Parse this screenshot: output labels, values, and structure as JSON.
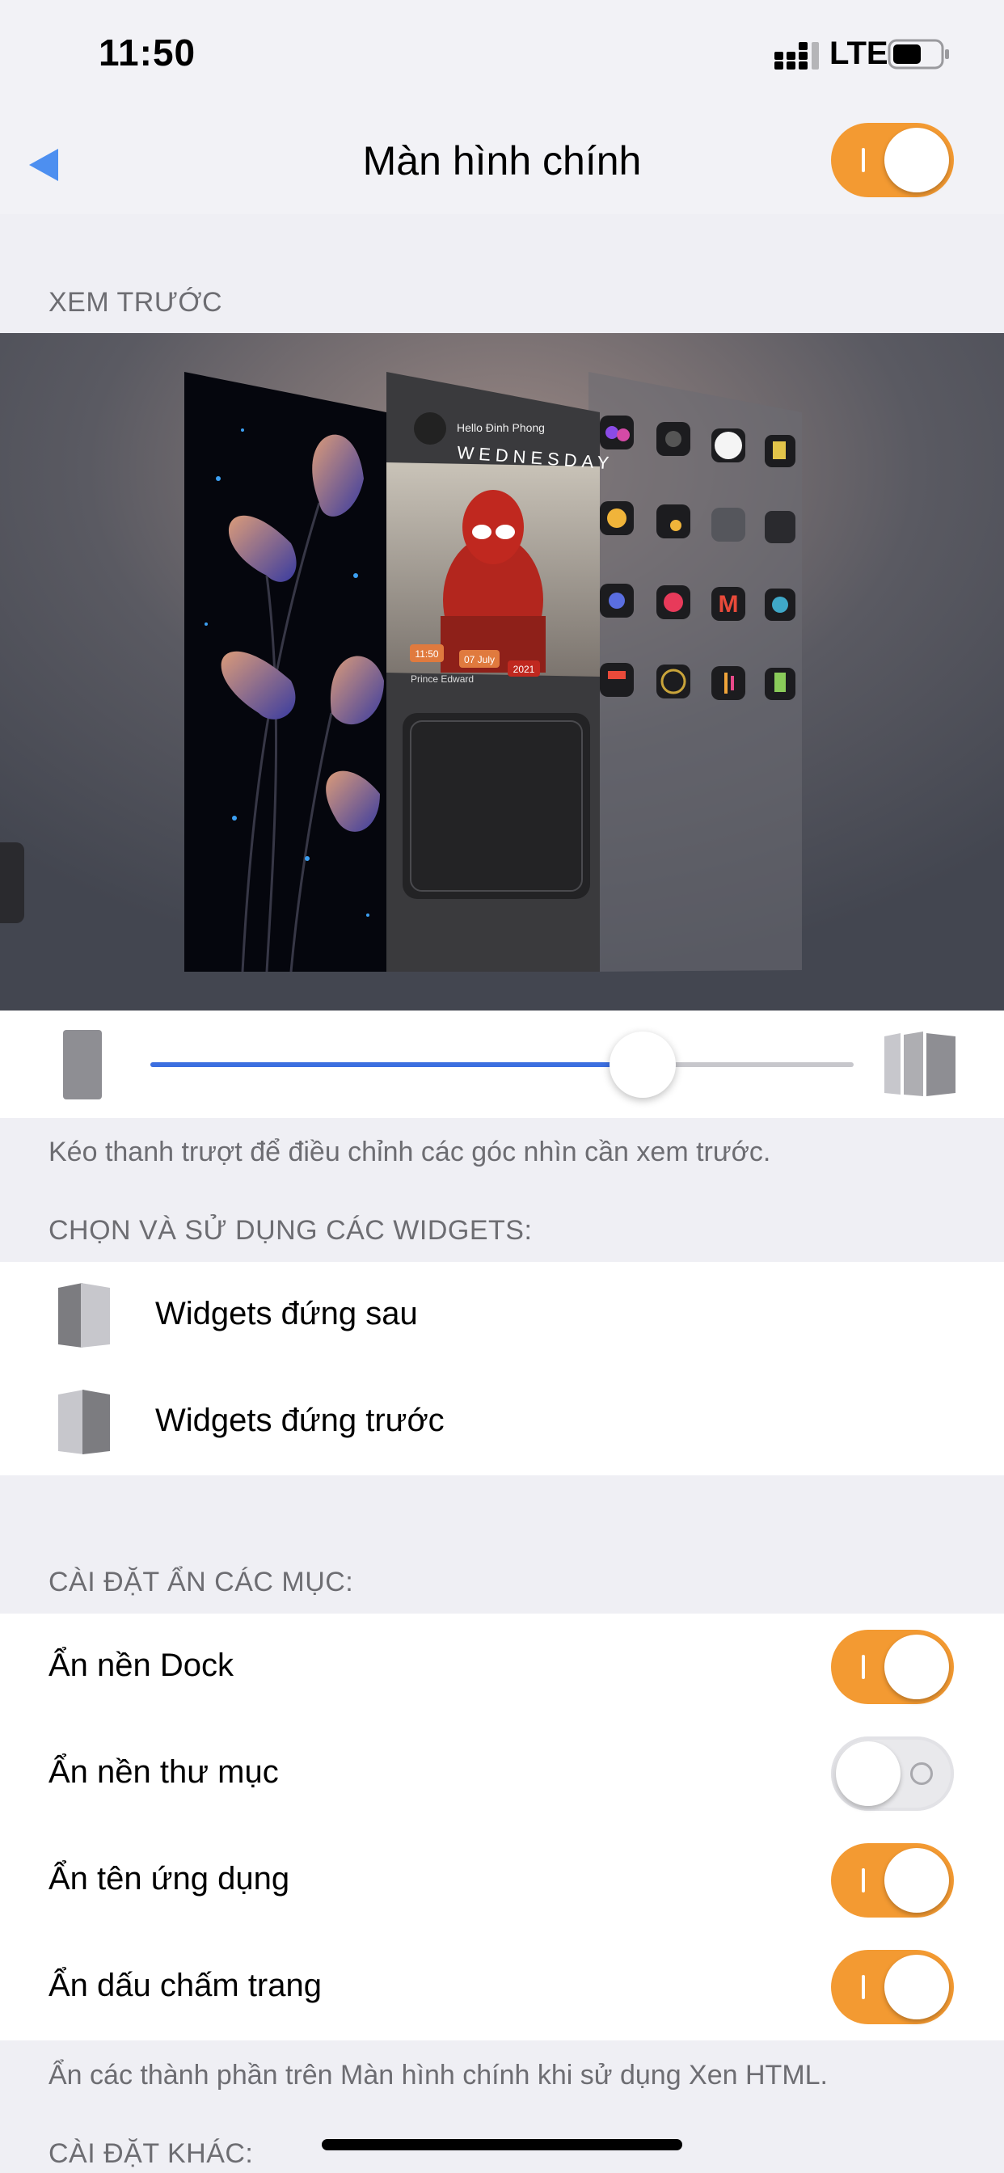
{
  "status_bar": {
    "time": "11:50",
    "network": "LTE"
  },
  "nav": {
    "title": "Màn hình chính",
    "enabled": true
  },
  "preview": {
    "header": "XEM TRƯỚC",
    "card": {
      "greeting": "Hello Đinh Phong",
      "day": "WEDNESDAY",
      "time_badge": "11:50",
      "date_badge": "07 July",
      "year_badge": "2021",
      "name_line": "Prince Edward"
    },
    "slider_value": 0.7,
    "footer": "Kéo thanh trượt để điều chỉnh các góc nhìn cần xem trước."
  },
  "widgets": {
    "header": "CHỌN VÀ SỬ DỤNG CÁC WIDGETS:",
    "items": [
      {
        "label": "Widgets đứng sau",
        "icon": "widgets-back-icon"
      },
      {
        "label": "Widgets đứng trước",
        "icon": "widgets-front-icon"
      }
    ]
  },
  "hide_settings": {
    "header": "CÀI ĐẶT ẨN CÁC MỤC:",
    "items": [
      {
        "label": "Ẩn nền Dock",
        "enabled": true
      },
      {
        "label": "Ẩn nền thư mục",
        "enabled": false
      },
      {
        "label": "Ẩn tên ứng dụng",
        "enabled": true
      },
      {
        "label": "Ẩn dấu chấm trang",
        "enabled": true
      }
    ],
    "footer": "Ẩn các thành phần trên Màn hình chính khi sử dụng Xen HTML."
  },
  "other_settings": {
    "header": "CÀI ĐẶT KHÁC:"
  },
  "colors": {
    "accent": "#f39a32",
    "slider": "#3c6fe0",
    "background": "#efeff4"
  }
}
